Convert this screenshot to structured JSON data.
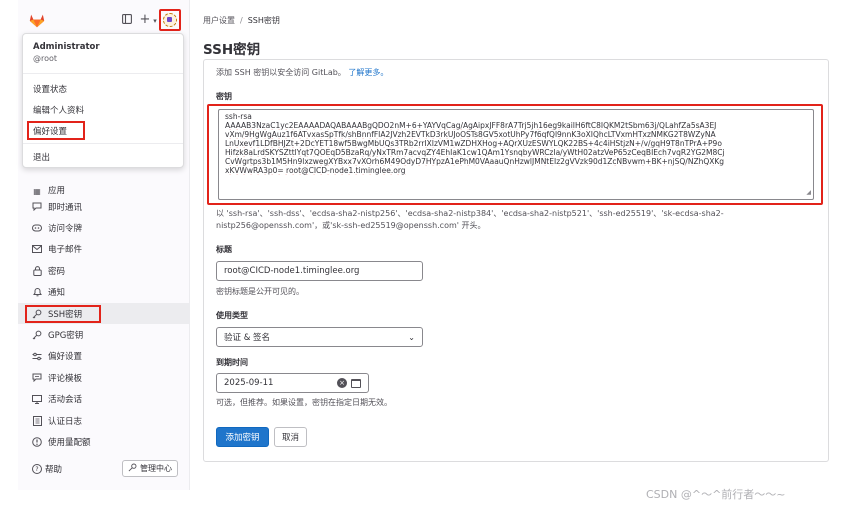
{
  "colors": {
    "accent": "#1f75cb",
    "highlight_box": "#e2231a",
    "sidebar_bg": "#fbfafd"
  },
  "sidebar": {
    "partial_item": "应用",
    "items": [
      {
        "label": "即时通讯",
        "icon": "chat-icon"
      },
      {
        "label": "访问令牌",
        "icon": "token-icon"
      },
      {
        "label": "电子邮件",
        "icon": "mail-icon"
      },
      {
        "label": "密码",
        "icon": "lock-icon"
      },
      {
        "label": "通知",
        "icon": "bell-icon"
      },
      {
        "label": "SSH密钥",
        "icon": "key-icon"
      },
      {
        "label": "GPG密钥",
        "icon": "key-icon"
      },
      {
        "label": "偏好设置",
        "icon": "preferences-icon"
      },
      {
        "label": "评论模板",
        "icon": "comment-icon"
      },
      {
        "label": "活动会话",
        "icon": "monitor-icon"
      },
      {
        "label": "认证日志",
        "icon": "log-icon"
      },
      {
        "label": "使用量配额",
        "icon": "quota-icon"
      }
    ],
    "help": "帮助",
    "admin": "管理中心"
  },
  "dropdown": {
    "name": "Administrator",
    "handle": "@root",
    "items": [
      "设置状态",
      "编辑个人资料",
      "偏好设置",
      "退出"
    ]
  },
  "breadcrumb": {
    "parent": "用户设置",
    "current": "SSH密钥"
  },
  "page_title": "SSH密钥",
  "intro": {
    "text": "添加 SSH 密钥以安全访问 GitLab。",
    "link": "了解更多。"
  },
  "form": {
    "key_label": "密钥",
    "key_lines": [
      "ssh-rsa",
      "AAAAB3NzaC1yc2EAAAADAQABAAABgQDO2nM+6+YAYVqCag/AgAipxJFF8rA7Trj5jh16eg9kaiIH6ftC8IQKM2tSbm63j/QLahfZa5sA3EJ",
      "vXm/9HgWgAuz1f6ATvxasSpTfk/shBnnfFIA2JVzh2EVTkD3rkUJoOSTs8GV5xotUhPy7f6qfQl9nnK3oXIQhcLTVxmHTxzNMKG2T8WZyNA",
      "LnUxevf1LDfBHJZt+2DcYET18wf5BwgMbUQs3TRb2rrIXIzVM1wZDHXHog+AQrXUzESWYLQK22BS+4c4iHStjzN+/v/gqH9T8nTPrA+P9o",
      "Hifzk8aLrdSKYSZttlYqt7QOEqD5BzaRq/yNxTRm7acvqZY4EhIaK1cw1QAm1YsnqbyWRCzIa/yWtH02atzVeP65zCeqBIEch7vqR2YG2M8Cj",
      "CvWgrtps3b1M5Hn9lxzwegXYBxx7vXOrh6M49OdyD7HYpzA1ePhM0VAaauQnHzwlJMNtEIz2gVVzk90d1ZcNBvwm+BK+njSQ/NZhQXKg",
      "xKVWwRA3p0= root@CICD-node1.timinglee.org"
    ],
    "key_help": "以 'ssh-rsa'、'ssh-dss'、'ecdsa-sha2-nistp256'、'ecdsa-sha2-nistp384'、'ecdsa-sha2-nistp521'、'ssh-ed25519'、'sk-ecdsa-sha2-nistp256@openssh.com'，或'sk-ssh-ed25519@openssh.com' 开头。",
    "title_label": "标题",
    "title_value": "root@CICD-node1.timinglee.org",
    "title_help": "密钥标题是公开可见的。",
    "usage_label": "使用类型",
    "usage_value": "验证 & 签名",
    "expire_label": "到期时间",
    "expire_value": "2025-09-11",
    "expire_help": "可选，但推荐。如果设置，密钥在指定日期无效。",
    "submit": "添加密钥",
    "cancel": "取消"
  },
  "watermark": "CSDN @^～^前行者～～~"
}
